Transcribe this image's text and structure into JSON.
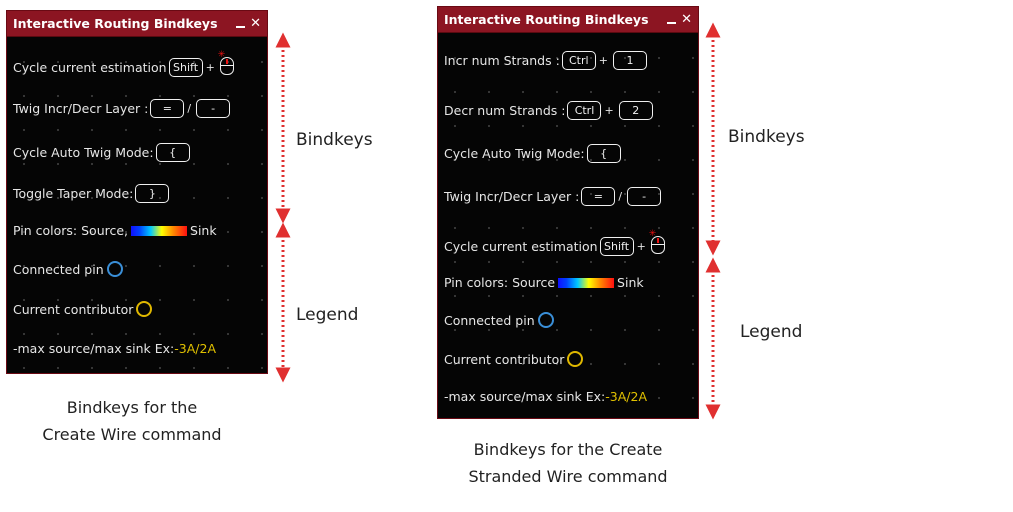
{
  "left_panel": {
    "title": "Interactive Routing Bindkeys",
    "rows": {
      "cycle_current": "Cycle current estimation",
      "shift_key": "Shift",
      "twig_layer": "Twig Incr/Decr Layer :",
      "equals_key": "=",
      "minus_key": "-",
      "cycle_twig": "Cycle Auto Twig Mode:",
      "brace_key": "{",
      "toggle_taper": "Toggle Taper Mode:",
      "close_brace_key": "}",
      "pin_colors_prefix": "Pin colors: Source,",
      "pin_colors_suffix": "Sink",
      "connected_pin": "Connected pin",
      "current_contributor": "Current contributor",
      "max_prefix": "-max source/max sink Ex:",
      "max_value": "-3A/2A"
    }
  },
  "right_panel": {
    "title": "Interactive Routing Bindkeys",
    "rows": {
      "incr_strands": "Incr num Strands :",
      "ctrl_key": "Ctrl",
      "one_key": "1",
      "decr_strands": "Decr num Strands :",
      "two_key": "2",
      "cycle_twig": "Cycle Auto Twig Mode:",
      "brace_key": "{",
      "twig_layer": "Twig Incr/Decr Layer :",
      "equals_key": "=",
      "minus_key": "-",
      "cycle_current": "Cycle current estimation",
      "shift_key": "Shift",
      "pin_colors_prefix": "Pin colors: Source",
      "pin_colors_suffix": "Sink",
      "connected_pin": "Connected pin",
      "current_contributor": "Current contributor",
      "max_prefix": "-max source/max sink Ex:",
      "max_value": "-3A/2A"
    }
  },
  "annotations": {
    "bindkeys": "Bindkeys",
    "legend": "Legend"
  },
  "captions": {
    "left_line1": "Bindkeys for the",
    "left_line2": "Create Wire command",
    "right_line1": "Bindkeys for the Create",
    "right_line2": "Stranded Wire command"
  },
  "colors": {
    "title_bar": "#8c1522",
    "panel_bg": "#050505",
    "arrow": "#e03030",
    "source_color": "#1010ff",
    "sink_color": "#ff1010",
    "connected_pin_circle": "#3a8fd8",
    "current_contributor_circle": "#e0b800"
  }
}
